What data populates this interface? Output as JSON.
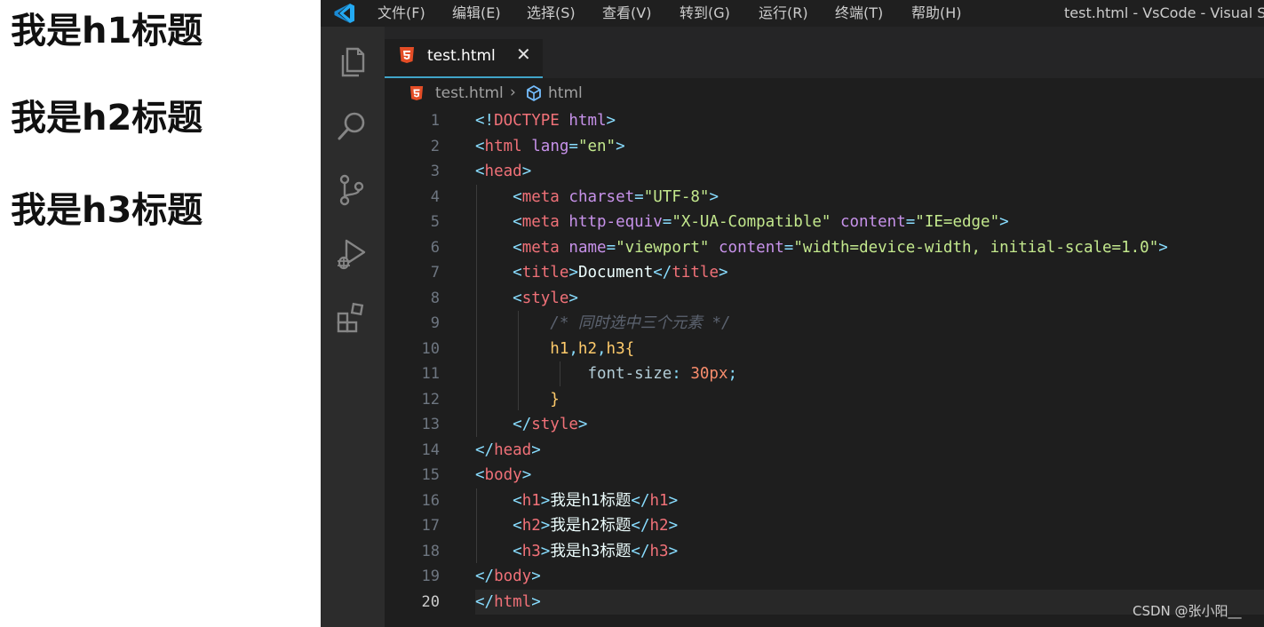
{
  "preview": {
    "h1": "我是h1标题",
    "h2": "我是h2标题",
    "h3": "我是h3标题"
  },
  "titlebar": {
    "menu": [
      "文件(F)",
      "编辑(E)",
      "选择(S)",
      "查看(V)",
      "转到(G)",
      "运行(R)",
      "终端(T)",
      "帮助(H)"
    ],
    "window_title": "test.html - VsCode - Visual S"
  },
  "activitybar": {
    "icons": [
      "explorer-icon",
      "search-icon",
      "source-control-icon",
      "run-debug-icon",
      "extensions-icon"
    ]
  },
  "tab": {
    "label": "test.html",
    "close": "✕"
  },
  "breadcrumb": {
    "file": "test.html",
    "separator": "›",
    "element": "html"
  },
  "editor": {
    "current_line": 20,
    "lines": [
      [
        [
          "br",
          "<!"
        ],
        [
          "tg",
          "DOCTYPE"
        ],
        [
          "tx",
          " "
        ],
        [
          "at",
          "html"
        ],
        [
          "br",
          ">"
        ]
      ],
      [
        [
          "br",
          "<"
        ],
        [
          "tg",
          "html"
        ],
        [
          "tx",
          " "
        ],
        [
          "at",
          "lang"
        ],
        [
          "eq",
          "="
        ],
        [
          "st",
          "\"en\""
        ],
        [
          "br",
          ">"
        ]
      ],
      [
        [
          "br",
          "<"
        ],
        [
          "tg",
          "head"
        ],
        [
          "br",
          ">"
        ]
      ],
      [
        [
          "tx",
          "    "
        ],
        [
          "br",
          "<"
        ],
        [
          "tg",
          "meta"
        ],
        [
          "tx",
          " "
        ],
        [
          "at",
          "charset"
        ],
        [
          "eq",
          "="
        ],
        [
          "st",
          "\"UTF-8\""
        ],
        [
          "br",
          ">"
        ]
      ],
      [
        [
          "tx",
          "    "
        ],
        [
          "br",
          "<"
        ],
        [
          "tg",
          "meta"
        ],
        [
          "tx",
          " "
        ],
        [
          "at",
          "http-equiv"
        ],
        [
          "eq",
          "="
        ],
        [
          "st",
          "\"X-UA-Compatible\""
        ],
        [
          "tx",
          " "
        ],
        [
          "at",
          "content"
        ],
        [
          "eq",
          "="
        ],
        [
          "st",
          "\"IE=edge\""
        ],
        [
          "br",
          ">"
        ]
      ],
      [
        [
          "tx",
          "    "
        ],
        [
          "br",
          "<"
        ],
        [
          "tg",
          "meta"
        ],
        [
          "tx",
          " "
        ],
        [
          "at",
          "name"
        ],
        [
          "eq",
          "="
        ],
        [
          "st",
          "\"viewport\""
        ],
        [
          "tx",
          " "
        ],
        [
          "at",
          "content"
        ],
        [
          "eq",
          "="
        ],
        [
          "st",
          "\"width=device-width, initial-scale=1.0\""
        ],
        [
          "br",
          ">"
        ]
      ],
      [
        [
          "tx",
          "    "
        ],
        [
          "br",
          "<"
        ],
        [
          "tg",
          "title"
        ],
        [
          "br",
          ">"
        ],
        [
          "tx",
          "Document"
        ],
        [
          "br",
          "</"
        ],
        [
          "tg",
          "title"
        ],
        [
          "br",
          ">"
        ]
      ],
      [
        [
          "tx",
          "    "
        ],
        [
          "br",
          "<"
        ],
        [
          "tg",
          "style"
        ],
        [
          "br",
          ">"
        ]
      ],
      [
        [
          "tx",
          "        "
        ],
        [
          "cm",
          "/* 同时选中三个元素 */"
        ]
      ],
      [
        [
          "tx",
          "        "
        ],
        [
          "sel",
          "h1"
        ],
        [
          "pn",
          ","
        ],
        [
          "sel",
          "h2"
        ],
        [
          "pn",
          ","
        ],
        [
          "sel",
          "h3"
        ],
        [
          "sel",
          "{"
        ]
      ],
      [
        [
          "tx",
          "            "
        ],
        [
          "pr",
          "font-size"
        ],
        [
          "pn",
          ":"
        ],
        [
          "tx",
          " "
        ],
        [
          "nu",
          "30px"
        ],
        [
          "pn",
          ";"
        ]
      ],
      [
        [
          "tx",
          "        "
        ],
        [
          "sel",
          "}"
        ]
      ],
      [
        [
          "tx",
          "    "
        ],
        [
          "br",
          "</"
        ],
        [
          "tg",
          "style"
        ],
        [
          "br",
          ">"
        ]
      ],
      [
        [
          "br",
          "</"
        ],
        [
          "tg",
          "head"
        ],
        [
          "br",
          ">"
        ]
      ],
      [
        [
          "br",
          "<"
        ],
        [
          "tg",
          "body"
        ],
        [
          "br",
          ">"
        ]
      ],
      [
        [
          "tx",
          "    "
        ],
        [
          "br",
          "<"
        ],
        [
          "tg",
          "h1"
        ],
        [
          "br",
          ">"
        ],
        [
          "tx",
          "我是h1标题"
        ],
        [
          "br",
          "</"
        ],
        [
          "tg",
          "h1"
        ],
        [
          "br",
          ">"
        ]
      ],
      [
        [
          "tx",
          "    "
        ],
        [
          "br",
          "<"
        ],
        [
          "tg",
          "h2"
        ],
        [
          "br",
          ">"
        ],
        [
          "tx",
          "我是h2标题"
        ],
        [
          "br",
          "</"
        ],
        [
          "tg",
          "h2"
        ],
        [
          "br",
          ">"
        ]
      ],
      [
        [
          "tx",
          "    "
        ],
        [
          "br",
          "<"
        ],
        [
          "tg",
          "h3"
        ],
        [
          "br",
          ">"
        ],
        [
          "tx",
          "我是h3标题"
        ],
        [
          "br",
          "</"
        ],
        [
          "tg",
          "h3"
        ],
        [
          "br",
          ">"
        ]
      ],
      [
        [
          "br",
          "</"
        ],
        [
          "tg",
          "body"
        ],
        [
          "br",
          ">"
        ]
      ],
      [
        [
          "br",
          "</"
        ],
        [
          "tg",
          "html"
        ],
        [
          "br",
          ">"
        ]
      ]
    ]
  },
  "watermark": "CSDN @张小阳__",
  "colors": {
    "tag": "#f07178",
    "bracket": "#89ddff",
    "attribute": "#c792ea",
    "string": "#c3e88d",
    "comment": "#5c6370",
    "selector": "#ffcb6b",
    "number": "#f78c6c",
    "tab_underline": "#40a4c8",
    "vscode_blue": "#23a9f2",
    "html5_orange": "#e44d26"
  }
}
